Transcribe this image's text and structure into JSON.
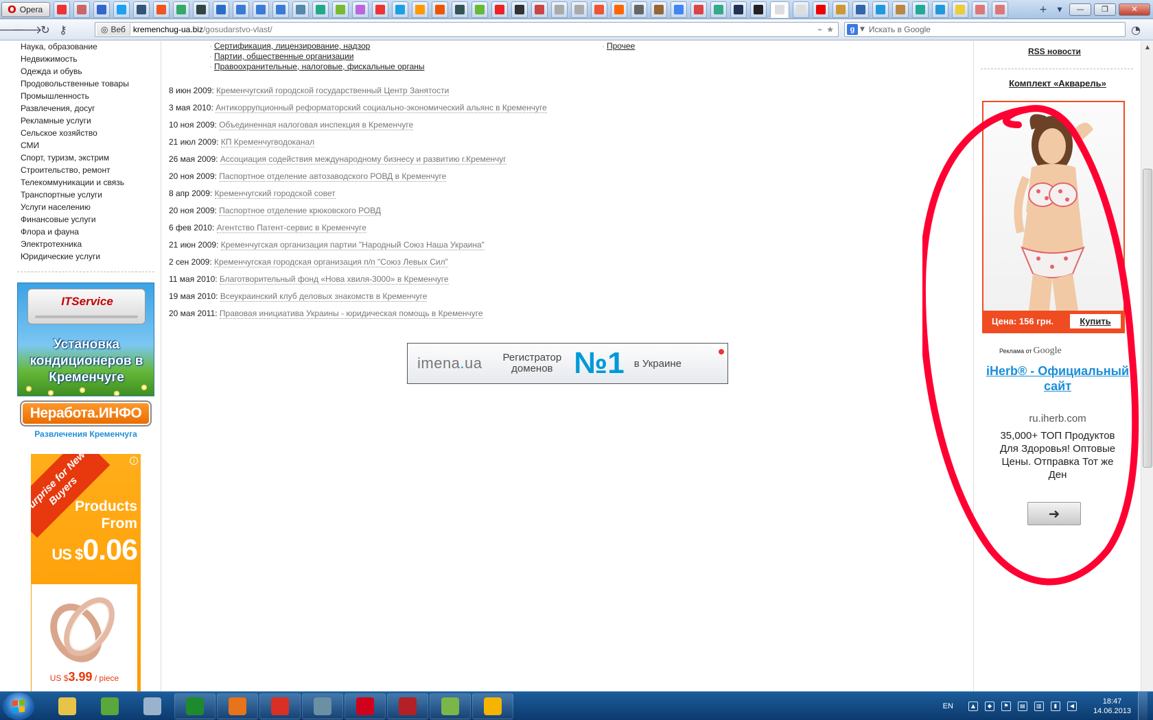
{
  "browser": {
    "menu_label": "Opera",
    "address_scope": "Веб",
    "address_host": "kremenchug-ua.biz",
    "address_path": "/gosudarstvo-vlast/",
    "search_placeholder": "Искать в Google",
    "search_engine_letter": "g",
    "tab_icon_colors": [
      "#e33",
      "#c66",
      "#36c",
      "#1da1f2",
      "#357",
      "#e52",
      "#3a6",
      "#344",
      "#2a6dc9",
      "#3a7bd5",
      "#3a7bd5",
      "#3a7bd5",
      "#58a",
      "#2a8",
      "#7b3",
      "#b6d",
      "#e33",
      "#1ba1e2",
      "#f90",
      "#e50",
      "#355",
      "#6b3",
      "#e22",
      "#333",
      "#c44",
      "#aaa",
      "#aaa",
      "#e53",
      "#f60",
      "#666",
      "#963",
      "#4285f4",
      "#d44",
      "#3a8",
      "#235",
      "#222",
      "#ddd",
      "#ddd",
      "#e00",
      "#c93",
      "#36a",
      "#29d",
      "#b84",
      "#2a9",
      "#29d",
      "#ec3",
      "#d77",
      "#d77"
    ]
  },
  "left": {
    "categories": [
      "Наука, образование",
      "Недвижимость",
      "Одежда и обувь",
      "Продовольственные товары",
      "Промышленность",
      "Развлечения, досуг",
      "Рекламные услуги",
      "Сельское хозяйство",
      "СМИ",
      "Спорт, туризм, экстрим",
      "Строительство, ремонт",
      "Телекоммуникации и связь",
      "Транспортные услуги",
      "Услуги населению",
      "Финансовые услуги",
      "Флора и фауна",
      "Электротехника",
      "Юридические услуги"
    ],
    "ad_it_brand": "ITService",
    "ad_it_text": "Установка кондиционеров в Кременчуге",
    "ad_nerabota_a": "Неработа.",
    "ad_nerabota_b": "ИНФО",
    "ad_nerabota_sub": "Развлечения Кременчуга",
    "ad_products_ribbon": "Surprise for New Buyers",
    "ad_products_from": "Products From",
    "ad_products_currency": "US $",
    "ad_products_price": "0.06",
    "ad_products_ring_currency": "US $",
    "ad_products_ring_price": "3.99",
    "ad_products_ring_unit": " / piece",
    "ad_products_info": "i"
  },
  "main": {
    "subcategories": [
      {
        "text": "Сертификация, лицензирование, надзор"
      },
      {
        "text": "Партии, общественные организации"
      },
      {
        "text": "Правоохранительные, налоговые, фискальные органы"
      },
      {
        "text": "Прочее"
      }
    ],
    "news": [
      {
        "date": "8 июн 2009:",
        "title": "Кременчугский городской государственный Центр Занятости"
      },
      {
        "date": "3 мая 2010:",
        "title": "Антикоррупционный реформаторский социально-экономический альянс в Кременчуге"
      },
      {
        "date": "10 ноя 2009:",
        "title": "Объединенная налоговая инспекция в Кременчуге"
      },
      {
        "date": "21 июл 2009:",
        "title": "КП Кременчугводоканал"
      },
      {
        "date": "26 мая 2009:",
        "title": "Ассоциация содействия международному бизнесу и развитию г.Кременчуг"
      },
      {
        "date": "20 ноя 2009:",
        "title": "Паспортное отделение автозаводского РОВД в Кременчуге"
      },
      {
        "date": "8 апр 2009:",
        "title": "Кременчугский городской совет"
      },
      {
        "date": "20 ноя 2009:",
        "title": "Паспортное отделение крюковского РОВД"
      },
      {
        "date": "6 фев 2010:",
        "title": "Агентство Патент-сервис в Кременчуге"
      },
      {
        "date": "21 июн 2009:",
        "title": "Кременчугская организация партии \"Народный Союз Наша Украина\""
      },
      {
        "date": "2 сен 2009:",
        "title": "Кременчугская городская организация п/п \"Союз Левых Сил\""
      },
      {
        "date": "11 мая 2010:",
        "title": "Благотворительный фонд «Нова хвиля-3000» в Кременчуге"
      },
      {
        "date": "19 мая 2010:",
        "title": "Всеукраинский клуб деловых знакомств в Кременчуге"
      },
      {
        "date": "20 мая 2011:",
        "title": "Правовая инициатива Украины - юридическая помощь в Кременчуге"
      }
    ],
    "banner_logo_a": "imena",
    "banner_logo_dot": ".",
    "banner_logo_b": "ua",
    "banner_reg_1": "Регистратор",
    "banner_reg_2": "доменов",
    "banner_num": "№1",
    "banner_ua": "в Украине"
  },
  "right": {
    "rss_label": "RSS новости",
    "promo_title": "Комплект «Акварель»",
    "promo_price": "Цена: 156 грн.",
    "promo_buy": "Купить",
    "ads_label": "Реклама от",
    "ads_google": "Google",
    "iherb_title": "iHerb® - Официальный сайт",
    "iherb_url": "ru.iherb.com",
    "iherb_desc": "35,000+ ТОП Продуктов Для Здоровья! Оптовые Цены. Отправка Тот же Ден",
    "annotation_color": "#ff0033"
  },
  "taskbar": {
    "lang": "EN",
    "time": "18:47",
    "date": "14.06.2013",
    "app_colors": [
      "#e8c34a",
      "#5aa83c",
      "#9bb2cc",
      "#1e8a2e",
      "#e7731b",
      "#d93025",
      "#6b8fa3",
      "#d0021b",
      "#b32025",
      "#7ab648",
      "#f4b400"
    ]
  }
}
